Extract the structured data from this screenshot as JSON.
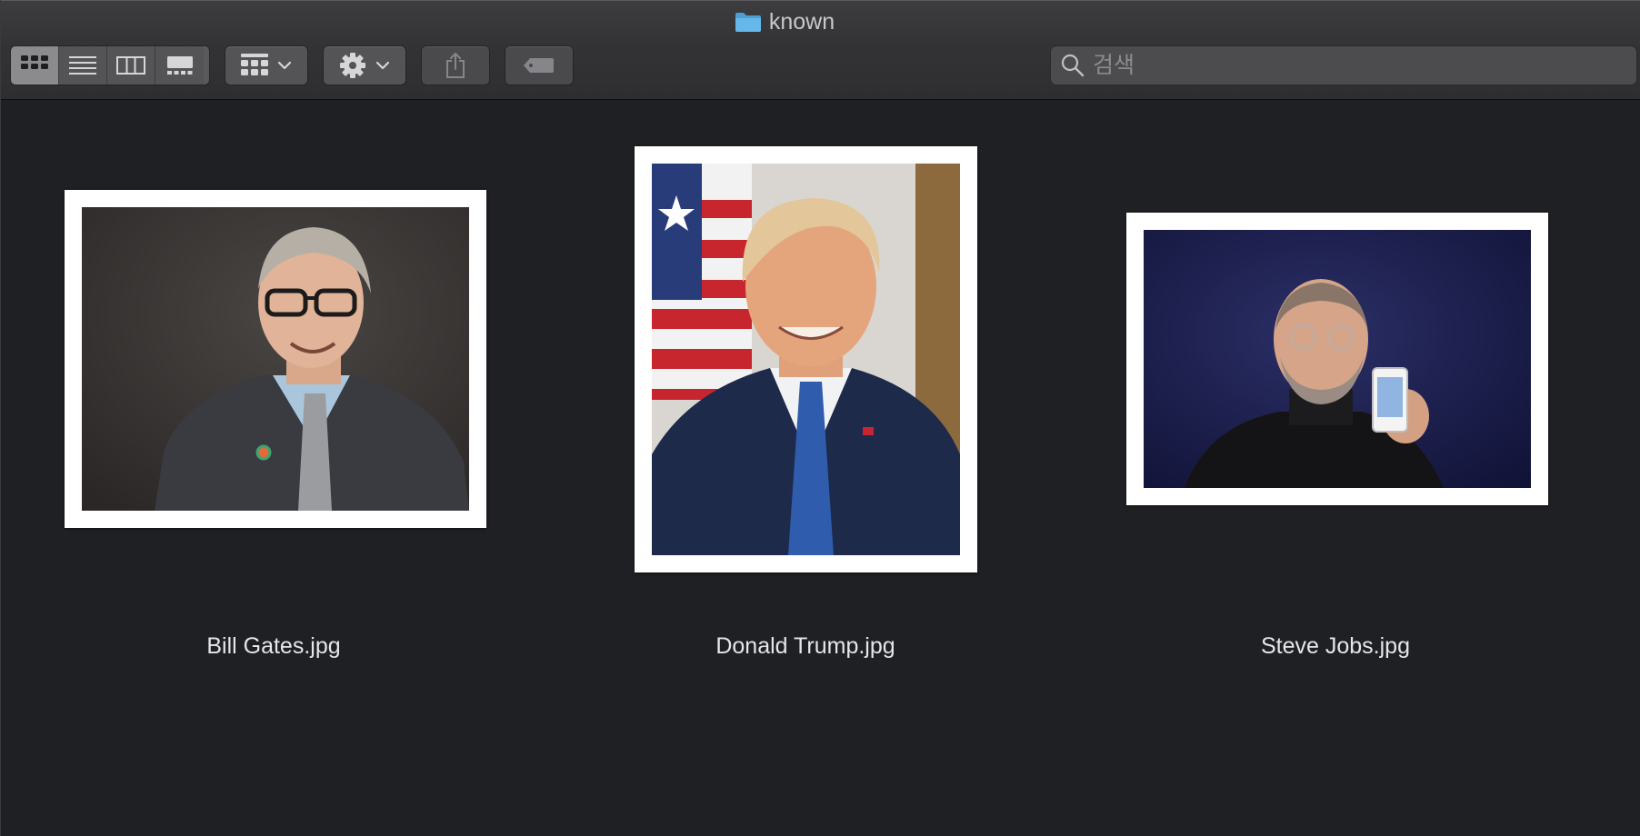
{
  "window": {
    "title": "known"
  },
  "toolbar": {
    "view_modes": [
      "icon-view",
      "list-view",
      "column-view",
      "gallery-view"
    ],
    "active_view": "icon-view",
    "group_button_icon": "group-grid-icon",
    "action_button_icon": "gear-icon",
    "share_button_icon": "share-icon",
    "tag_button_icon": "tag-icon"
  },
  "search": {
    "placeholder": "검색",
    "value": ""
  },
  "files": [
    {
      "name": "Bill Gates.jpg",
      "thumbnail": "portrait-man-glasses-dark-gray-background"
    },
    {
      "name": "Donald Trump.jpg",
      "thumbnail": "portrait-man-blue-tie-flag-background"
    },
    {
      "name": "Steve Jobs.jpg",
      "thumbnail": "man-black-turtleneck-holding-phone-navy-background"
    }
  ],
  "colors": {
    "folder_blue": "#5aaee0",
    "background": "#1f2024",
    "toolbar": "#333336",
    "active_segment": "#8b8b8e"
  }
}
